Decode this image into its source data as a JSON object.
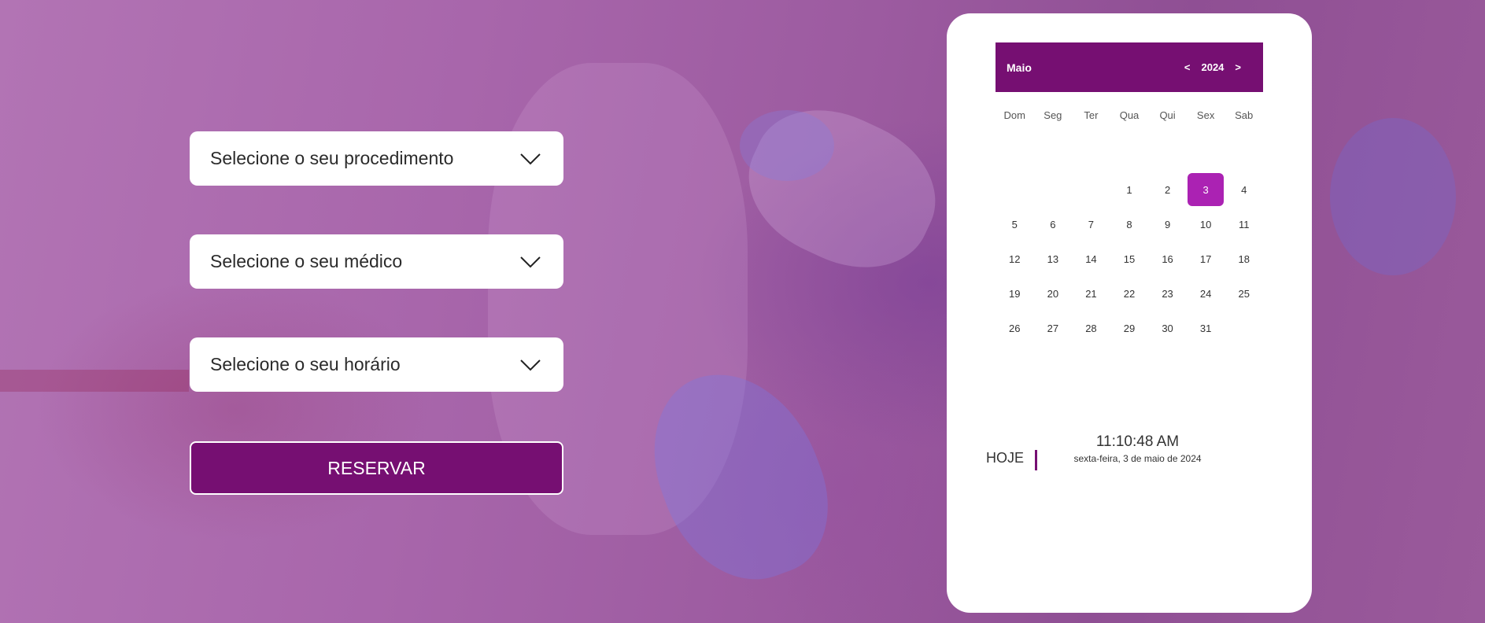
{
  "form": {
    "procedure_label": "Selecione o seu procedimento",
    "doctor_label": "Selecione o seu médico",
    "time_label": "Selecione o seu horário",
    "reserve_label": "RESERVAR"
  },
  "calendar": {
    "month": "Maio",
    "year": "2024",
    "prev_label": "<",
    "next_label": ">",
    "weekdays": [
      "Dom",
      "Seg",
      "Ter",
      "Qua",
      "Qui",
      "Sex",
      "Sab"
    ],
    "leading_blanks": 3,
    "days": [
      "1",
      "2",
      "3",
      "4",
      "5",
      "6",
      "7",
      "8",
      "9",
      "10",
      "11",
      "12",
      "13",
      "14",
      "15",
      "16",
      "17",
      "18",
      "19",
      "20",
      "21",
      "22",
      "23",
      "24",
      "25",
      "26",
      "27",
      "28",
      "29",
      "30",
      "31"
    ],
    "selected_day": "3"
  },
  "today": {
    "label": "HOJE",
    "time": "11:10:48 AM",
    "date": "sexta-feira, 3 de maio de 2024"
  },
  "colors": {
    "accent": "#760f72",
    "selected": "#ab22b3"
  }
}
